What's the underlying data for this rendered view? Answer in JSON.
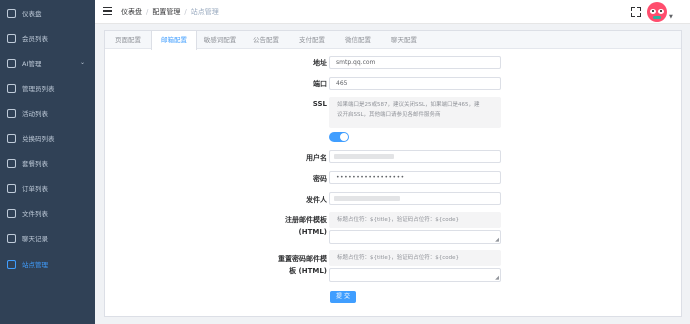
{
  "sidebar": {
    "items": [
      {
        "label": "仪表盘",
        "icon": "dashboard-icon"
      },
      {
        "label": "会员列表",
        "icon": "user-icon"
      },
      {
        "label": "AI管理",
        "icon": "ai-icon",
        "has_submenu": true
      },
      {
        "label": "管理员列表",
        "icon": "admin-icon"
      },
      {
        "label": "活动列表",
        "icon": "activity-icon"
      },
      {
        "label": "兑换码列表",
        "icon": "code-icon"
      },
      {
        "label": "套餐列表",
        "icon": "package-icon"
      },
      {
        "label": "订单列表",
        "icon": "order-icon"
      },
      {
        "label": "文件列表",
        "icon": "file-icon"
      },
      {
        "label": "聊天记录",
        "icon": "chat-icon"
      },
      {
        "label": "站点管理",
        "icon": "site-icon",
        "active": true
      }
    ],
    "active_color": "#409eff",
    "background": "#304156"
  },
  "header": {
    "breadcrumbs": [
      "仪表盘",
      "配置管理",
      "站点管理"
    ]
  },
  "tabs": [
    {
      "label": "页面配置"
    },
    {
      "label": "邮箱配置",
      "active": true
    },
    {
      "label": "敏感词配置"
    },
    {
      "label": "公告配置"
    },
    {
      "label": "支付配置"
    },
    {
      "label": "微信配置"
    },
    {
      "label": "聊天配置"
    }
  ],
  "form": {
    "address": {
      "label": "地址",
      "value": "smtp.qq.com"
    },
    "port": {
      "label": "端口",
      "value": "465"
    },
    "ssl": {
      "label": "SSL",
      "note_line1": "如果端口是25或587，建议关闭SSL，如果端口是465，建",
      "note_line2": "议开启SSL，其他端口请参见各邮件服务商",
      "enabled": true
    },
    "username": {
      "label": "用户名"
    },
    "password": {
      "label": "密码",
      "value": "•••••••••••••••••"
    },
    "sender": {
      "label": "发件人"
    },
    "register_template": {
      "label_line1": "注册邮件模板",
      "label_line2": "(HTML)",
      "hint": "标题占位符：${title}，验证码占位符：${code}"
    },
    "reset_template": {
      "label_line1": "重置密码邮件模",
      "label_line2": "板 (HTML)",
      "hint": "标题占位符：${title}，验证码占位符：${code}"
    },
    "submit_label": "提 交"
  }
}
